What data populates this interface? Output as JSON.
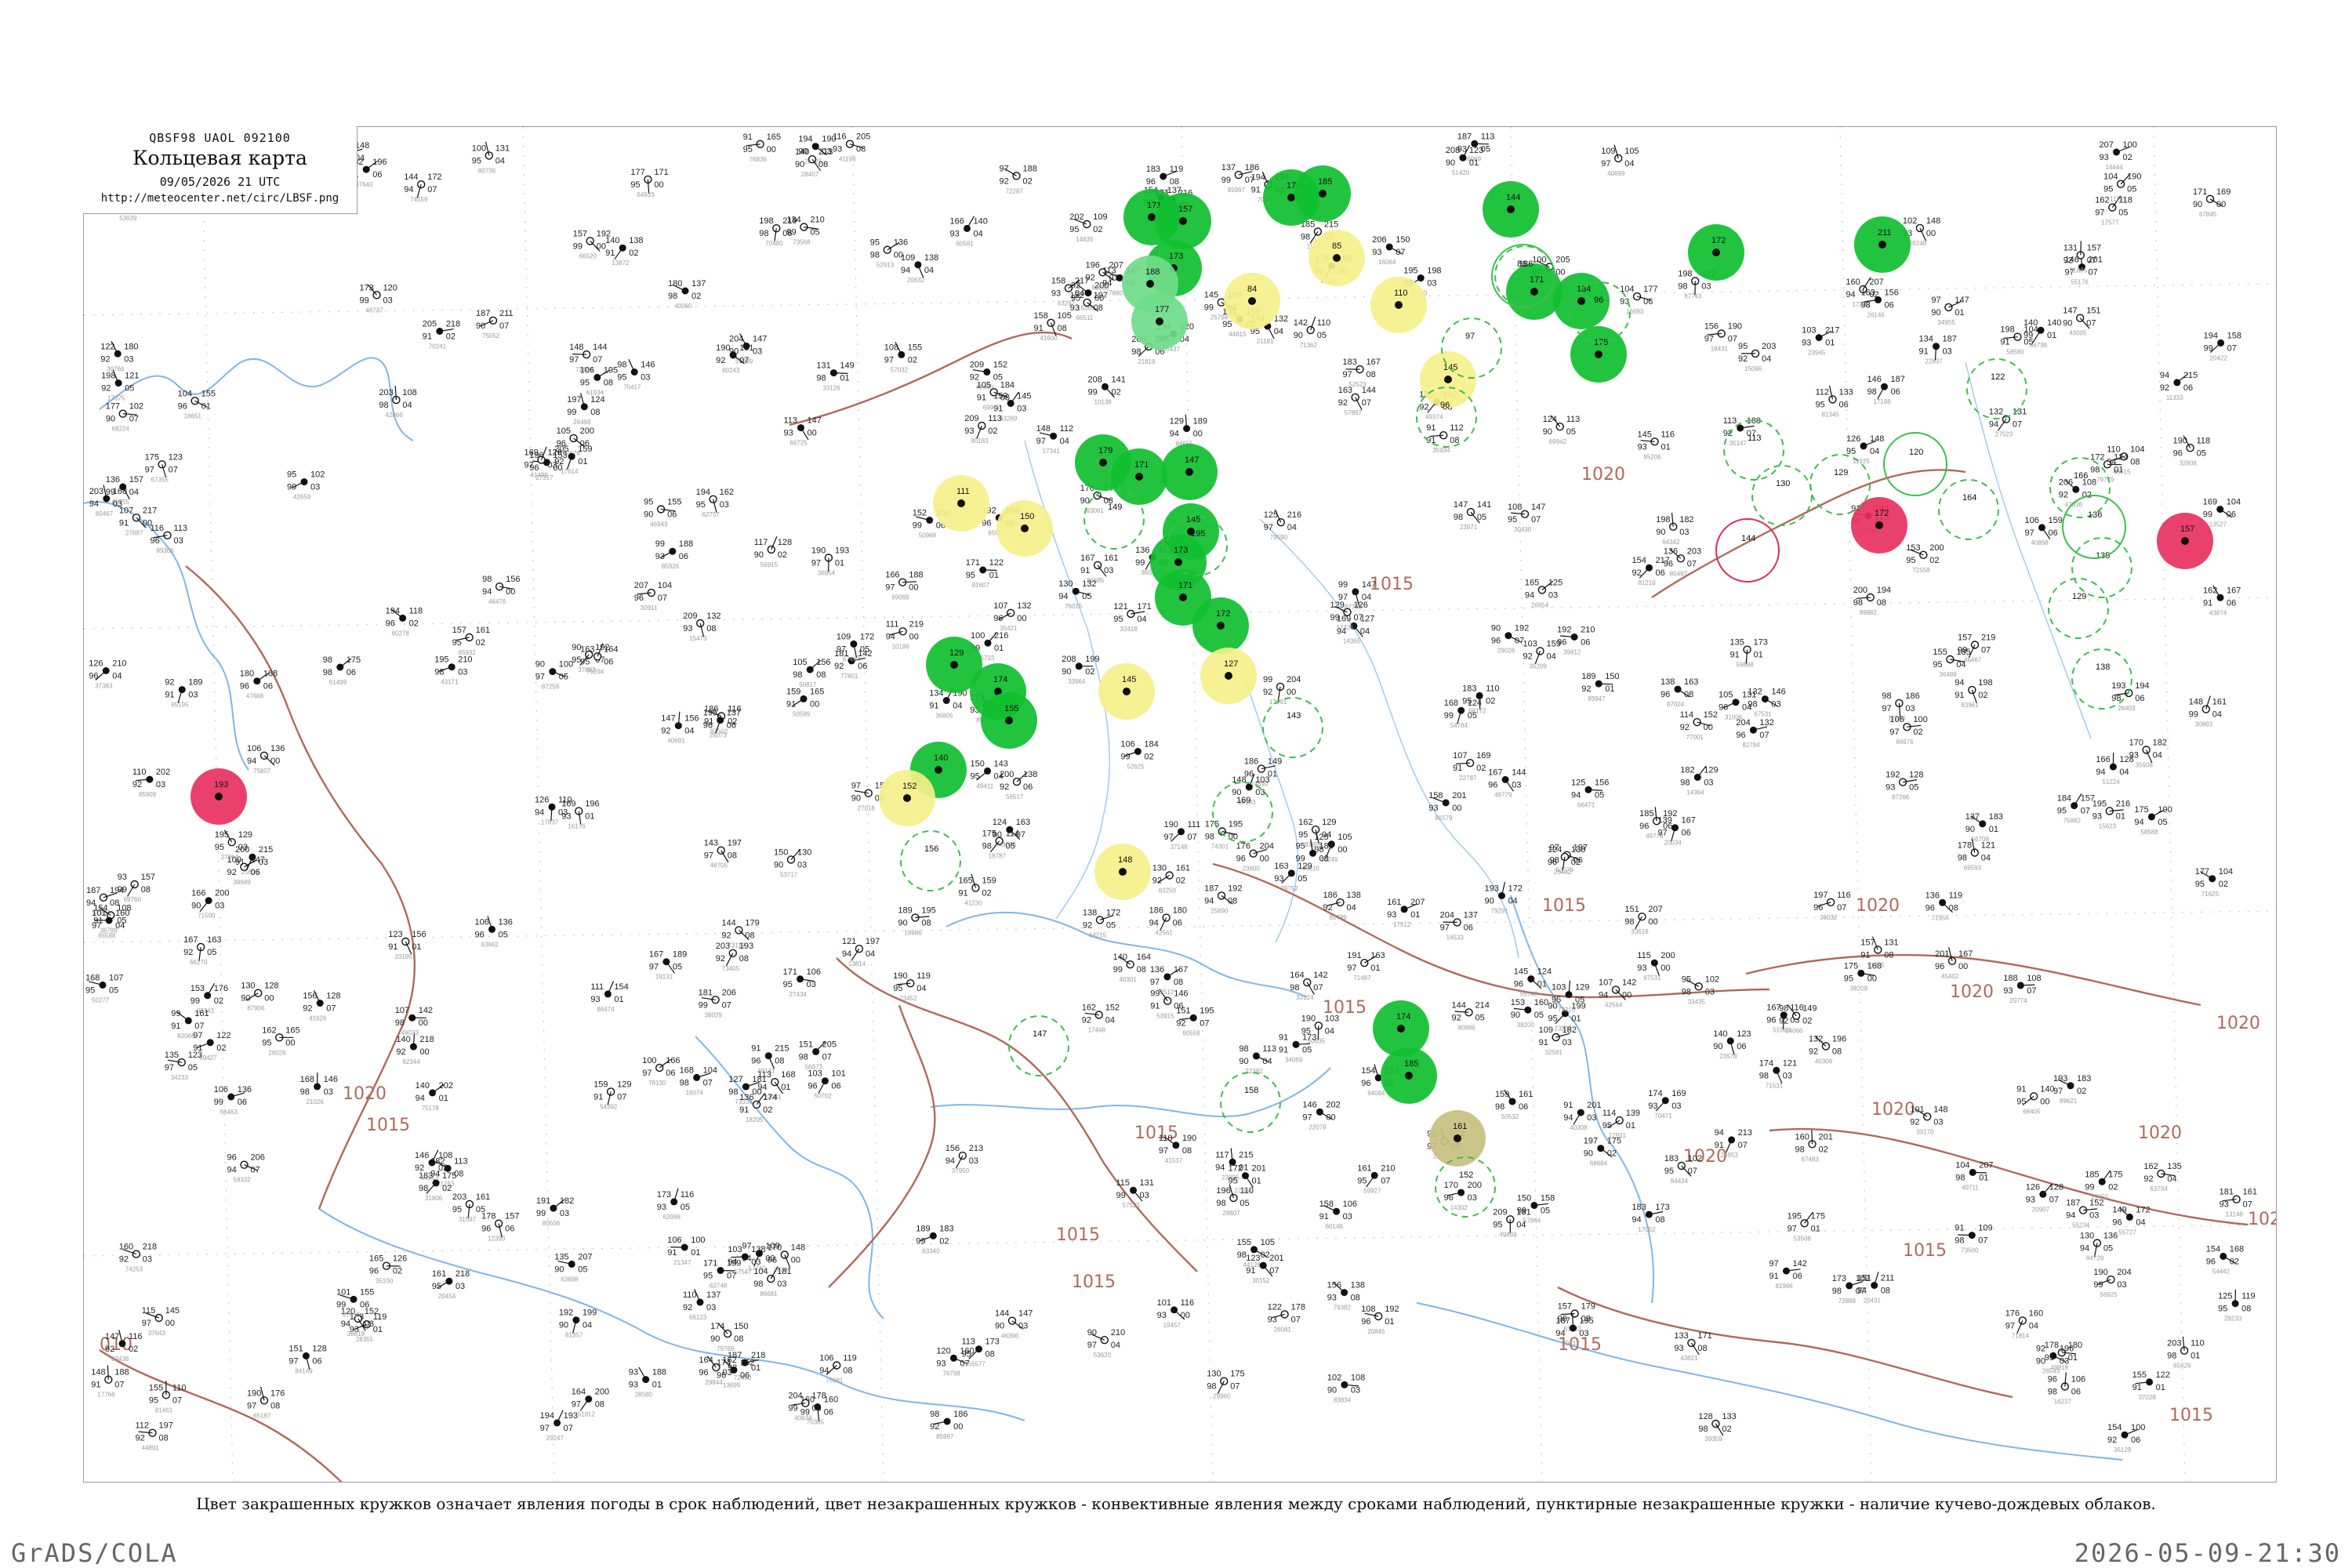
{
  "header": {
    "product_code": "QBSF98  UAOL  092100",
    "title": "Кольцевая карта",
    "datetime": "09/05/2026 21 UTC",
    "url": "http://meteocenter.net/circ/LBSF.png"
  },
  "caption": "Цвет закрашенных кружков означает явления погоды в срок наблюдений, цвет незакрашенных кружков - конвективные явления между сроками наблюдений, пунктирные незакрашенные кружки - наличие кучево-дождевых облаков.",
  "footer": {
    "left": "GrADS/COLA",
    "right": "2026-05-09-21:30"
  },
  "colors": {
    "coast": "#7fb6e8",
    "isobar": "#b06a5a",
    "green_marker": "#0fbf2f",
    "green_light_marker": "#6fdc8a",
    "yellow_marker": "#f5f08a",
    "red_marker": "#e8305f",
    "olive_marker": "#c8c080",
    "dashed_ring": "#3cbf4c",
    "solid_ring_red": "#d8304f"
  },
  "isobar_labels": [
    "1015",
    "1020",
    "1015",
    "1015",
    "1020",
    "1020",
    "1020",
    "1020",
    "1020",
    "1015",
    "1015",
    "1015",
    "1015",
    "1015",
    "1020",
    "1015",
    "1015",
    "010",
    "102",
    "1020"
  ],
  "markers": {
    "filled": [
      {
        "kind": "green",
        "label": "171"
      },
      {
        "kind": "green",
        "label": "157"
      },
      {
        "kind": "green",
        "label": "173"
      },
      {
        "kind": "green",
        "label": "179"
      },
      {
        "kind": "green",
        "label": "185"
      },
      {
        "kind": "green",
        "label": "144"
      },
      {
        "kind": "green",
        "label": "172"
      },
      {
        "kind": "green",
        "label": "211"
      },
      {
        "kind": "green",
        "label": "171"
      },
      {
        "kind": "green",
        "label": "184"
      },
      {
        "kind": "green",
        "label": "175"
      },
      {
        "kind": "green",
        "label": "179"
      },
      {
        "kind": "green",
        "label": "171"
      },
      {
        "kind": "green",
        "label": "147"
      },
      {
        "kind": "green",
        "label": "145"
      },
      {
        "kind": "green",
        "label": "173"
      },
      {
        "kind": "green",
        "label": "171"
      },
      {
        "kind": "green",
        "label": "172"
      },
      {
        "kind": "green",
        "label": "129"
      },
      {
        "kind": "green",
        "label": "174"
      },
      {
        "kind": "green",
        "label": "155"
      },
      {
        "kind": "green",
        "label": "140"
      },
      {
        "kind": "green",
        "label": "174"
      },
      {
        "kind": "green",
        "label": "185"
      },
      {
        "kind": "green_light",
        "label": "188"
      },
      {
        "kind": "green_light",
        "label": "177"
      },
      {
        "kind": "yellow",
        "label": "84"
      },
      {
        "kind": "yellow",
        "label": "85"
      },
      {
        "kind": "yellow",
        "label": "110"
      },
      {
        "kind": "yellow",
        "label": "145"
      },
      {
        "kind": "yellow",
        "label": "111"
      },
      {
        "kind": "yellow",
        "label": "150"
      },
      {
        "kind": "yellow",
        "label": "127"
      },
      {
        "kind": "yellow",
        "label": "145"
      },
      {
        "kind": "yellow",
        "label": "152"
      },
      {
        "kind": "yellow",
        "label": "148"
      },
      {
        "kind": "red",
        "label": "172"
      },
      {
        "kind": "red",
        "label": "157"
      },
      {
        "kind": "red",
        "label": "193"
      },
      {
        "kind": "olive",
        "label": "161"
      }
    ],
    "dashed_rings": [
      "186",
      "96",
      "97",
      "96",
      "113",
      "130",
      "129",
      "164",
      "122",
      "166",
      "135",
      "129",
      "138",
      "195",
      "143",
      "169",
      "147",
      "158",
      "152",
      "156",
      "149"
    ],
    "solid_rings": [
      "86",
      "120",
      "144",
      "136"
    ]
  }
}
